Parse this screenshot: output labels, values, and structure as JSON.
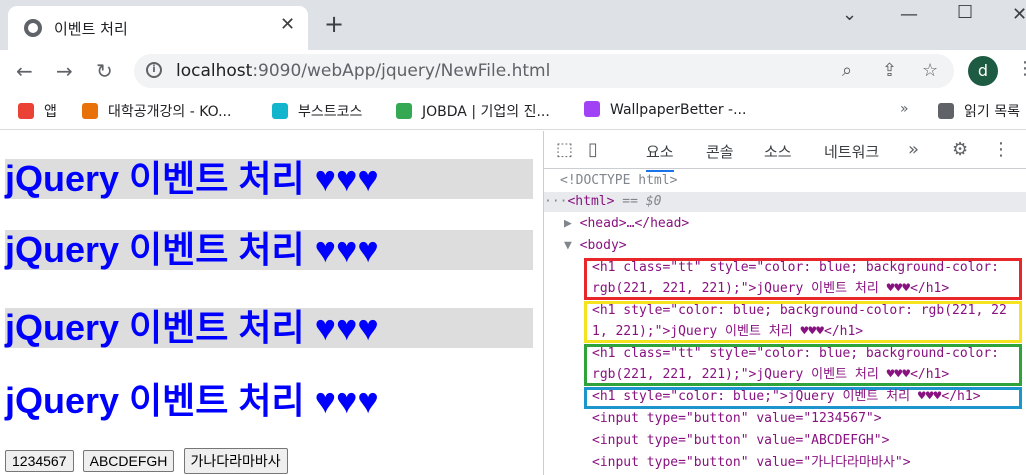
{
  "browser": {
    "tab_title": "이벤트 처리",
    "url_host": "localhost",
    "url_path": ":9090/webApp/jquery/NewFile.html",
    "avatar_letter": "d"
  },
  "bookmarks": [
    {
      "label": "앱",
      "color": "#ea4335"
    },
    {
      "label": "대학공개강의 - KO...",
      "color": "#e8710a"
    },
    {
      "label": "부스트코스",
      "color": "#12b5cb"
    },
    {
      "label": "JOBDA | 기업의 진...",
      "color": "#34a853"
    },
    {
      "label": "WallpaperBetter -...",
      "color": "#a142f4"
    },
    {
      "label": "읽기 목록",
      "color": "#5f6368"
    }
  ],
  "page": {
    "heading_text": "jQuery 이벤트 처리 ♥♥♥",
    "buttons": [
      "1234567",
      "ABCDEFGH",
      "가나다라마바사"
    ]
  },
  "devtools": {
    "tabs": [
      "요소",
      "콘솔",
      "소스",
      "네트워크"
    ],
    "lines": {
      "doctype": "<!DOCTYPE html>",
      "html_open": "<html>",
      "html_dollar": " == $0",
      "head": "<head>…</head>",
      "body": "<body>",
      "h1_1a": "<h1 class=\"tt\" style=\"color: blue; background-color:",
      "h1_1b": "rgb(221, 221, 221);\">jQuery 이벤트 처리 ♥♥♥</h1>",
      "h1_2a": "<h1 style=\"color: blue; background-color: rgb(221, 22",
      "h1_2b": "1, 221);\">jQuery 이벤트 처리 ♥♥♥</h1>",
      "h1_3a": "<h1 class=\"tt\" style=\"color: blue; background-color:",
      "h1_3b": "rgb(221, 221, 221);\">jQuery 이벤트 처리 ♥♥♥</h1>",
      "h1_4": "<h1 style=\"color: blue;\">jQuery 이벤트 처리 ♥♥♥</h1>",
      "input_1": "<input type=\"button\" value=\"1234567\">",
      "input_2": "<input type=\"button\" value=\"ABCDEFGH\">",
      "input_3": "<input type=\"button\" value=\"가나다라마바사\">"
    },
    "highlight_colors": [
      "#e8272a",
      "#f5e31f",
      "#2ea33a",
      "#1b95cc"
    ]
  }
}
